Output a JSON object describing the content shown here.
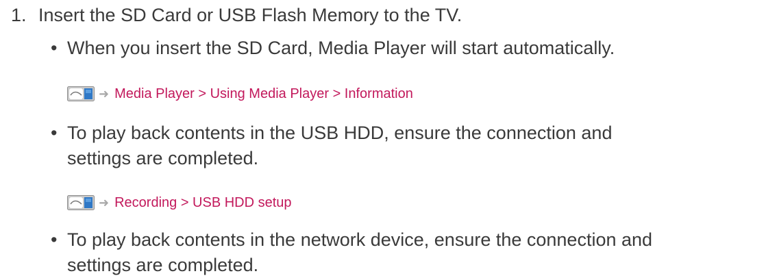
{
  "step": {
    "number": "1.",
    "text": "Insert the SD Card or USB Flash Memory to the TV."
  },
  "bullets": [
    {
      "symbol": "•",
      "lines": [
        "When you insert the SD Card, Media Player will start automatically."
      ]
    },
    {
      "symbol": "•",
      "lines": [
        "To play back contents in the USB HDD, ensure the connection and",
        "settings are completed."
      ]
    },
    {
      "symbol": "•",
      "lines": [
        "To play back contents in the network device, ensure the connection and",
        "settings are completed."
      ]
    }
  ],
  "references": [
    {
      "icon": "tv-menu-icon",
      "arrow": "➜",
      "link_text": "Media Player > Using Media Player > Information"
    },
    {
      "icon": "tv-menu-icon",
      "arrow": "➜",
      "link_text": "Recording > USB HDD setup"
    }
  ],
  "colors": {
    "body_text": "#3a3a3a",
    "link": "#c2185b",
    "arrow": "#a8a8a8"
  }
}
